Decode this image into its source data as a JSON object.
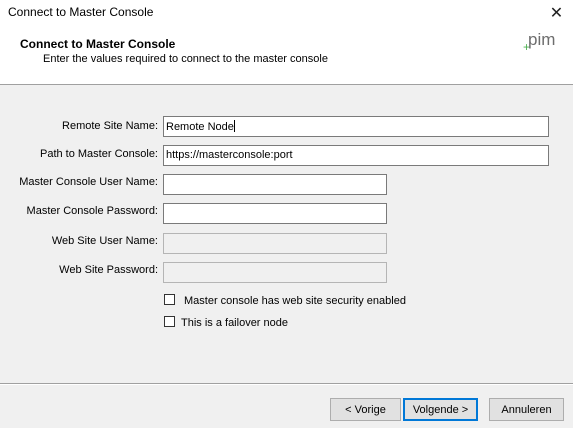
{
  "window": {
    "title": "Connect to Master Console",
    "close_glyph": "✕"
  },
  "header": {
    "title": "Connect to Master Console",
    "subtitle": "Enter the values required to connect to the master console",
    "logo_text": "pim",
    "logo_plus": "+"
  },
  "form": {
    "remote_site_name": {
      "label": "Remote Site Name:",
      "value": "Remote Node"
    },
    "path_to_master_console": {
      "label": "Path to Master Console:",
      "value": "https://masterconsole:port"
    },
    "master_console_user_name": {
      "label": "Master Console User Name:",
      "value": ""
    },
    "master_console_password": {
      "label": "Master Console Password:",
      "value": ""
    },
    "web_site_user_name": {
      "label": "Web Site User Name:",
      "value": ""
    },
    "web_site_password": {
      "label": "Web Site Password:",
      "value": ""
    }
  },
  "checkboxes": {
    "web_site_security": {
      "label": "Master console has web site security enabled",
      "checked": false
    },
    "failover_node": {
      "label": "This is a failover node",
      "checked": false
    }
  },
  "buttons": {
    "back": "< Vorige",
    "next": "Volgende >",
    "cancel": "Annuleren"
  },
  "colors": {
    "logo_green": "#4caf50",
    "logo_grey": "#6d6d6d",
    "default_button_border": "#0078d7"
  }
}
